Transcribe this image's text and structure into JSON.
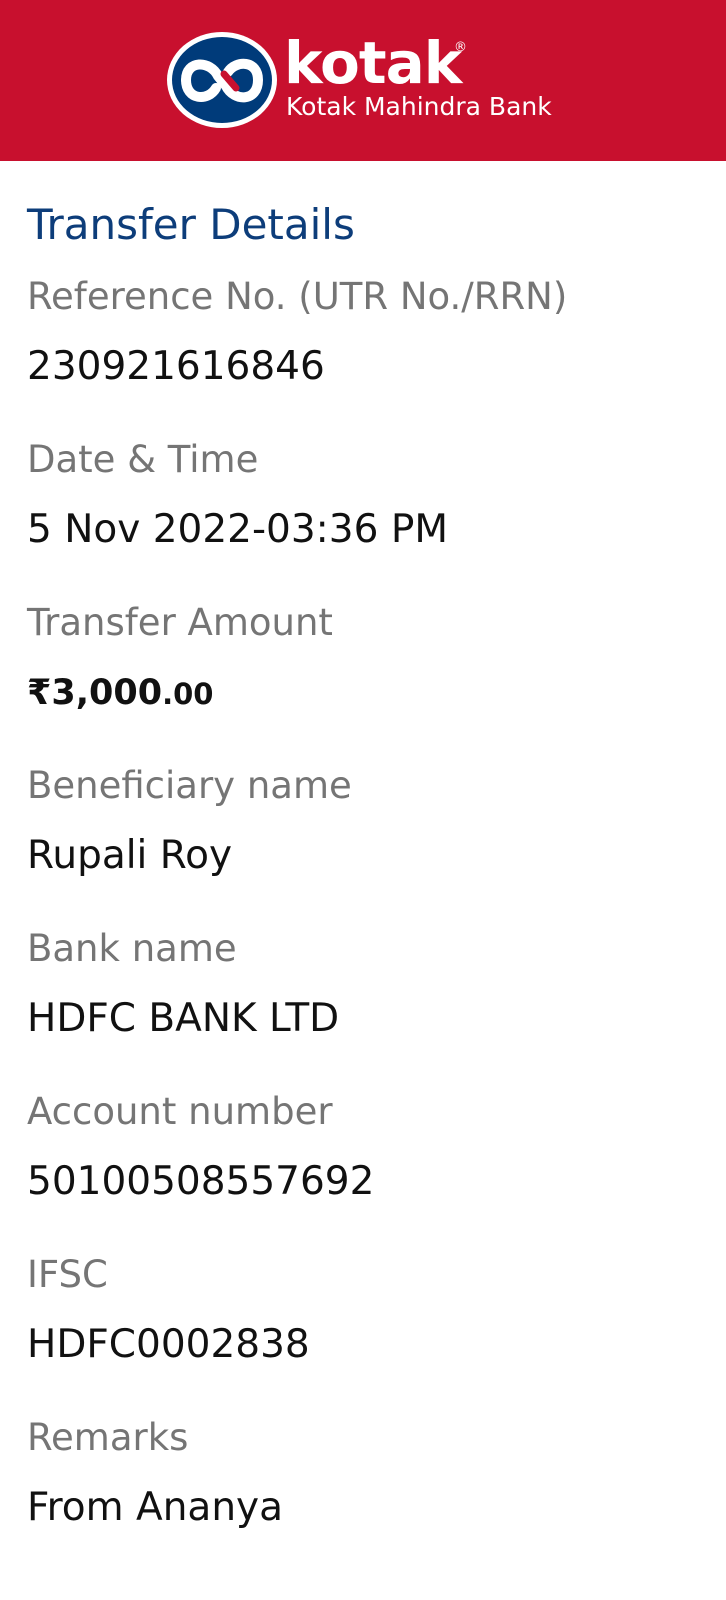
{
  "header": {
    "brand_name": "kotak",
    "brand_reg": "®",
    "brand_full": "Kotak Mahindra Bank",
    "bg_color": "#c8102e",
    "logo_icon": "kotak-infinity-logo"
  },
  "transfer": {
    "title": "Transfer Details",
    "fields": [
      {
        "label": "Reference No. (UTR No./RRN)",
        "value": "230921616846"
      },
      {
        "label": "Date & Time",
        "value": "5 Nov 2022-03:36 PM"
      },
      {
        "label": "Transfer Amount",
        "value_main": "₹3,000",
        "value_dec": ".00"
      },
      {
        "label": "Beneficiary name",
        "value": "Rupali Roy"
      },
      {
        "label": "Bank name",
        "value": "HDFC BANK LTD"
      },
      {
        "label": "Account number",
        "value": "50100508557692"
      },
      {
        "label": "IFSC",
        "value": "HDFC0002838"
      },
      {
        "label": "Remarks",
        "value": "From Ananya"
      }
    ]
  }
}
